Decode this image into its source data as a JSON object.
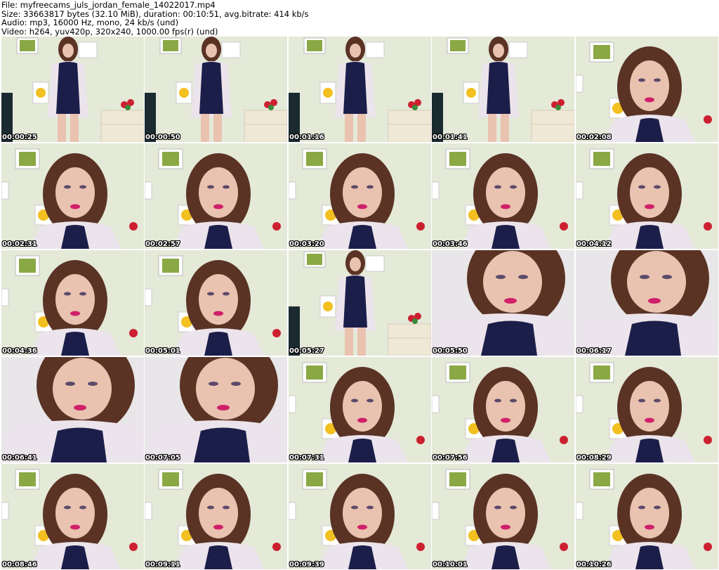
{
  "header": {
    "file_line": "File: myfreecams_juls_jordan_female_14022017.mp4",
    "size_line": "Size: 33663817 bytes (32.10 MiB), duration: 00:10:51, avg.bitrate: 414 kb/s",
    "audio_line": "Audio: mp3, 16000 Hz, mono, 24 kb/s (und)",
    "video_line": "Video: h264, yuv420p, 320x240, 1000.00 fps(r) (und)"
  },
  "grid": {
    "columns": 5,
    "rows": 5
  },
  "thumbnails": [
    {
      "timestamp": "00:00:25",
      "scene": "full"
    },
    {
      "timestamp": "00:00:50",
      "scene": "full"
    },
    {
      "timestamp": "00:01:16",
      "scene": "full"
    },
    {
      "timestamp": "00:01:41",
      "scene": "full"
    },
    {
      "timestamp": "00:02:08",
      "scene": "close"
    },
    {
      "timestamp": "00:02:31",
      "scene": "close"
    },
    {
      "timestamp": "00:02:57",
      "scene": "close"
    },
    {
      "timestamp": "00:03:20",
      "scene": "close"
    },
    {
      "timestamp": "00:03:46",
      "scene": "close"
    },
    {
      "timestamp": "00:04:12",
      "scene": "close"
    },
    {
      "timestamp": "00:04:36",
      "scene": "close"
    },
    {
      "timestamp": "00:05:01",
      "scene": "close"
    },
    {
      "timestamp": "00:05:27",
      "scene": "full"
    },
    {
      "timestamp": "00:05:50",
      "scene": "closeup"
    },
    {
      "timestamp": "00:06:17",
      "scene": "closeup"
    },
    {
      "timestamp": "00:06:41",
      "scene": "closeup"
    },
    {
      "timestamp": "00:07:05",
      "scene": "closeup"
    },
    {
      "timestamp": "00:07:31",
      "scene": "close"
    },
    {
      "timestamp": "00:07:56",
      "scene": "close"
    },
    {
      "timestamp": "00:08:29",
      "scene": "close"
    },
    {
      "timestamp": "00:08:46",
      "scene": "close"
    },
    {
      "timestamp": "00:09:11",
      "scene": "close"
    },
    {
      "timestamp": "00:09:39",
      "scene": "close"
    },
    {
      "timestamp": "00:10:01",
      "scene": "close"
    },
    {
      "timestamp": "00:10:26",
      "scene": "close"
    }
  ],
  "colors": {
    "wall": "#e4e9d8",
    "jacket": "#ece4ec",
    "dress": "#1c1e4a",
    "hair": "#5a3324",
    "skin": "#e9c3b0",
    "lips": "#d0206a",
    "frame_green": "#8aa844",
    "cabinet": "#f0e8d6",
    "flower_red": "#cc2030"
  }
}
